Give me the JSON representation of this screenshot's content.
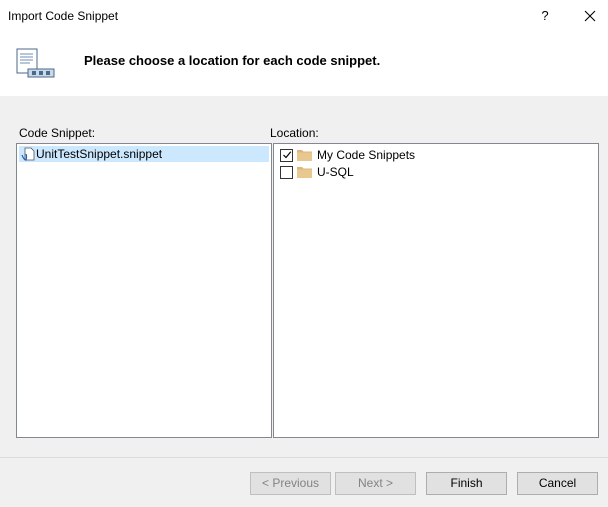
{
  "window": {
    "title": "Import Code Snippet",
    "help_label": "?"
  },
  "header": {
    "instruction": "Please choose a location for each code snippet."
  },
  "snippets": {
    "label": "Code Snippet:",
    "items": [
      {
        "label": "UnitTestSnippet.snippet",
        "selected": true
      }
    ]
  },
  "locations": {
    "label": "Location:",
    "items": [
      {
        "label": "My Code Snippets",
        "checked": true
      },
      {
        "label": "U-SQL",
        "checked": false
      }
    ]
  },
  "buttons": {
    "previous": "< Previous",
    "next": "Next >",
    "finish": "Finish",
    "cancel": "Cancel"
  },
  "colors": {
    "selection": "#cce8ff",
    "content_bg": "#f0f0f0",
    "folder": "#dcb67a"
  }
}
